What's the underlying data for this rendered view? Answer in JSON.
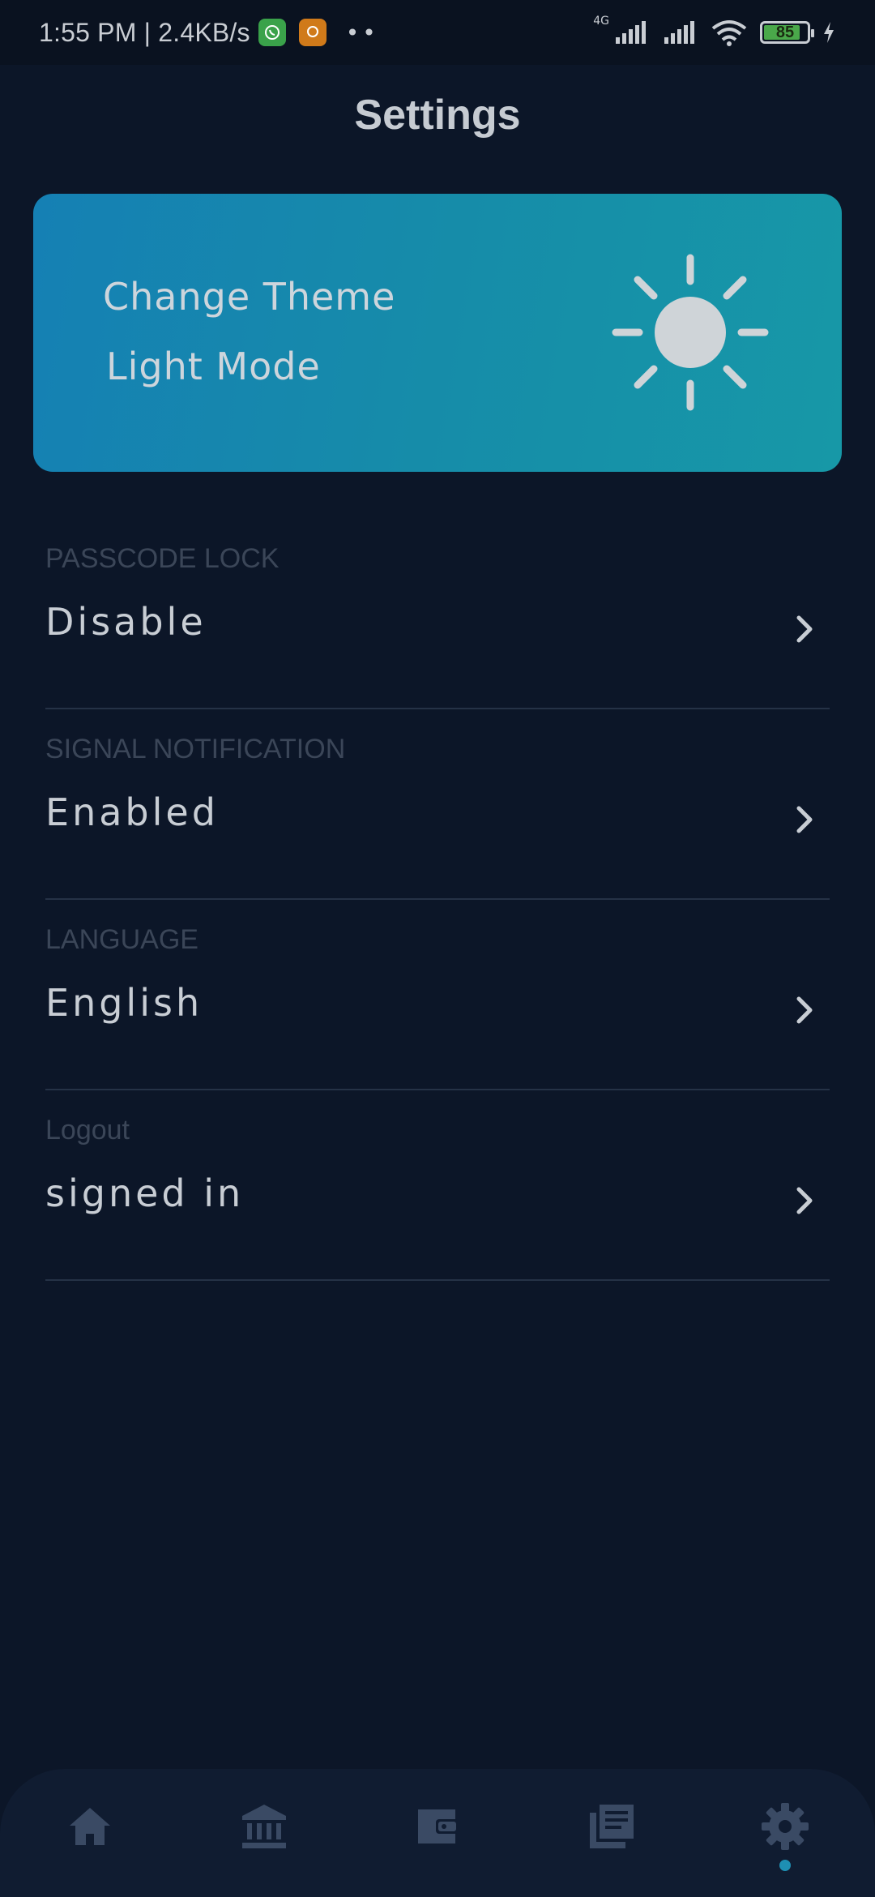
{
  "status_bar": {
    "time_speed": "1:55 PM | 2.4KB/s",
    "dots": "••",
    "network": "4G",
    "battery_level": "85",
    "battery_fraction": 0.85
  },
  "header": {
    "title": "Settings"
  },
  "theme_card": {
    "title": "Change Theme",
    "mode": "Light Mode",
    "icon": "sun-icon"
  },
  "settings": [
    {
      "label": "PASSCODE LOCK",
      "value": "Disable"
    },
    {
      "label": "SIGNAL NOTIFICATION",
      "value": "Enabled"
    },
    {
      "label": "LANGUAGE",
      "value": "English"
    },
    {
      "label": "Logout",
      "value": "signed in"
    }
  ],
  "bottom_nav": {
    "items": [
      "home-icon",
      "bank-icon",
      "wallet-icon",
      "news-icon",
      "gear-icon"
    ],
    "active": "gear-icon"
  },
  "colors": {
    "background": "#0c1628",
    "card_gradient_start": "#1580b4",
    "card_gradient_end": "#1798a7",
    "accent": "#1e8fb3"
  }
}
